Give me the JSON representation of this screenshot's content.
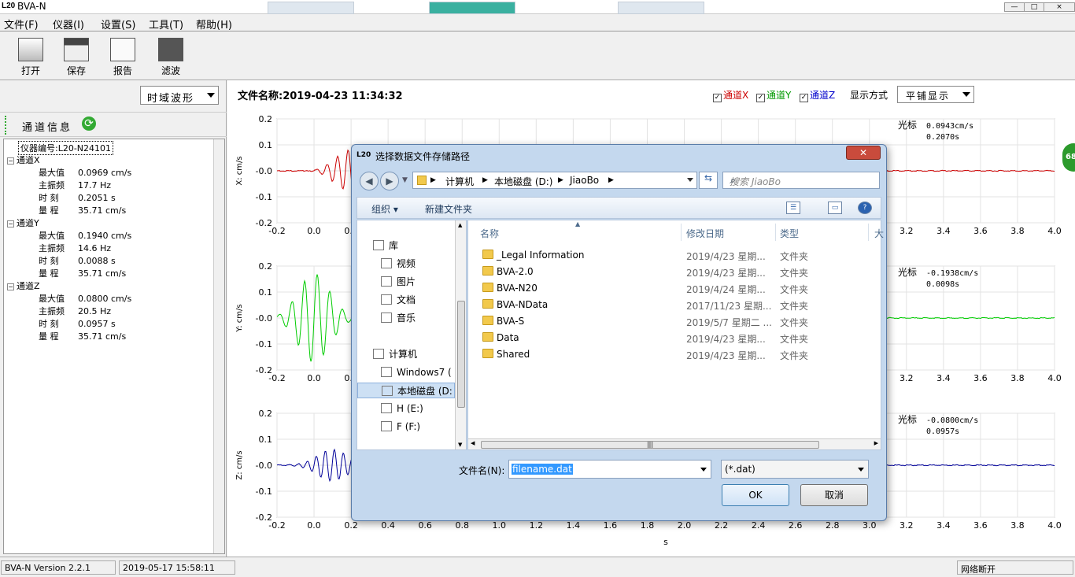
{
  "window": {
    "logo": "L20",
    "title": "BVA-N",
    "min": "—",
    "max": "□",
    "close": "×"
  },
  "taskbar_tabs": [
    "",
    "",
    ""
  ],
  "menu": [
    "文件(F)",
    "仪器(I)",
    "设置(S)",
    "工具(T)",
    "帮助(H)"
  ],
  "toolbar": [
    "打开",
    "保存",
    "报告",
    "滤波"
  ],
  "left": {
    "view_select": "时域波形",
    "channel_header": "通道信息",
    "device_id": "仪器编号:L20-N24101",
    "channels": [
      {
        "name": "通道X",
        "rows": [
          [
            "最大值",
            "0.0969 cm/s"
          ],
          [
            "主振频",
            "17.7 Hz"
          ],
          [
            "时 刻",
            "0.2051 s"
          ],
          [
            "量 程",
            "35.71 cm/s"
          ]
        ]
      },
      {
        "name": "通道Y",
        "rows": [
          [
            "最大值",
            "0.1940 cm/s"
          ],
          [
            "主振频",
            "14.6 Hz"
          ],
          [
            "时 刻",
            "0.0088 s"
          ],
          [
            "量 程",
            "35.71 cm/s"
          ]
        ]
      },
      {
        "name": "通道Z",
        "rows": [
          [
            "最大值",
            "0.0800 cm/s"
          ],
          [
            "主振频",
            "20.5 Hz"
          ],
          [
            "时 刻",
            "0.0957 s"
          ],
          [
            "量 程",
            "35.71 cm/s"
          ]
        ]
      }
    ]
  },
  "right": {
    "file_label": "文件名称:2019-04-23 11:34:32",
    "checks": [
      {
        "label": "通道X",
        "color": "#cc0000"
      },
      {
        "label": "通道Y",
        "color": "#009900"
      },
      {
        "label": "通道Z",
        "color": "#0000cc"
      }
    ],
    "mode_label": "显示方式",
    "mode_value": "平铺显示",
    "cursor_label": "光标",
    "plots": [
      {
        "ylabel": "X: cm/s",
        "color": "#cc0000",
        "cursor_value": "0.0943cm/s",
        "cursor_time": "0.2070s"
      },
      {
        "ylabel": "Y: cm/s",
        "color": "#00cc00",
        "cursor_value": "-0.1938cm/s",
        "cursor_time": "0.0098s"
      },
      {
        "ylabel": "Z: cm/s",
        "color": "#000099",
        "cursor_value": "-0.0800cm/s",
        "cursor_time": "0.0957s"
      }
    ],
    "yticks": [
      "0.2",
      "0.1",
      "-0.0",
      "-0.1",
      "-0.2"
    ],
    "xticks": [
      "-0.2",
      "0.0",
      "0.2",
      "0.4",
      "0.6",
      "0.8",
      "1.0",
      "1.2",
      "1.4",
      "1.6",
      "1.8",
      "2.0",
      "2.2",
      "2.4",
      "2.6",
      "2.8",
      "3.0",
      "3.2",
      "3.4",
      "3.6",
      "3.8",
      "4.0"
    ],
    "xlabel": "s"
  },
  "edge_badge": "68",
  "status": {
    "version": "BVA-N Version 2.2.1",
    "datetime": "2019-05-17 15:58:11",
    "network": "网络断开"
  },
  "dialog": {
    "logo": "L20",
    "title": "选择数据文件存储路径",
    "close": "✕",
    "path": [
      "计算机",
      "本地磁盘 (D:)",
      "JiaoBo"
    ],
    "search_placeholder": "搜索 JiaoBo",
    "organize": "组织 ▾",
    "new_folder": "新建文件夹",
    "nav_items": [
      {
        "label": "库",
        "icon": "library-icon",
        "indent": 0
      },
      {
        "label": "视频",
        "icon": "video-icon",
        "indent": 1
      },
      {
        "label": "图片",
        "icon": "picture-icon",
        "indent": 1
      },
      {
        "label": "文档",
        "icon": "document-icon",
        "indent": 1
      },
      {
        "label": "音乐",
        "icon": "music-icon",
        "indent": 1
      },
      {
        "label": "计算机",
        "icon": "computer-icon",
        "indent": 0
      },
      {
        "label": "Windows7 (",
        "icon": "drive-icon",
        "indent": 1
      },
      {
        "label": "本地磁盘 (D:",
        "icon": "drive-icon",
        "indent": 1
      },
      {
        "label": "H  (E:)",
        "icon": "drive-icon",
        "indent": 1
      },
      {
        "label": "F (F:)",
        "icon": "drive-icon",
        "indent": 1
      }
    ],
    "columns": [
      "名称",
      "修改日期",
      "类型",
      "大"
    ],
    "files": [
      {
        "name": "_Legal Information",
        "date": "2019/4/23 星期...",
        "type": "文件夹"
      },
      {
        "name": "BVA-2.0",
        "date": "2019/4/23 星期...",
        "type": "文件夹"
      },
      {
        "name": "BVA-N20",
        "date": "2019/4/24 星期...",
        "type": "文件夹"
      },
      {
        "name": "BVA-NData",
        "date": "2017/11/23 星期...",
        "type": "文件夹"
      },
      {
        "name": "BVA-S",
        "date": "2019/5/7 星期二 ...",
        "type": "文件夹"
      },
      {
        "name": "Data",
        "date": "2019/4/23 星期...",
        "type": "文件夹"
      },
      {
        "name": "Shared",
        "date": "2019/4/23 星期...",
        "type": "文件夹"
      }
    ],
    "filename_label": "文件名(N):",
    "filename_value": "filename.dat",
    "filetype_value": "(*.dat)",
    "ok": "OK",
    "cancel": "取消"
  }
}
